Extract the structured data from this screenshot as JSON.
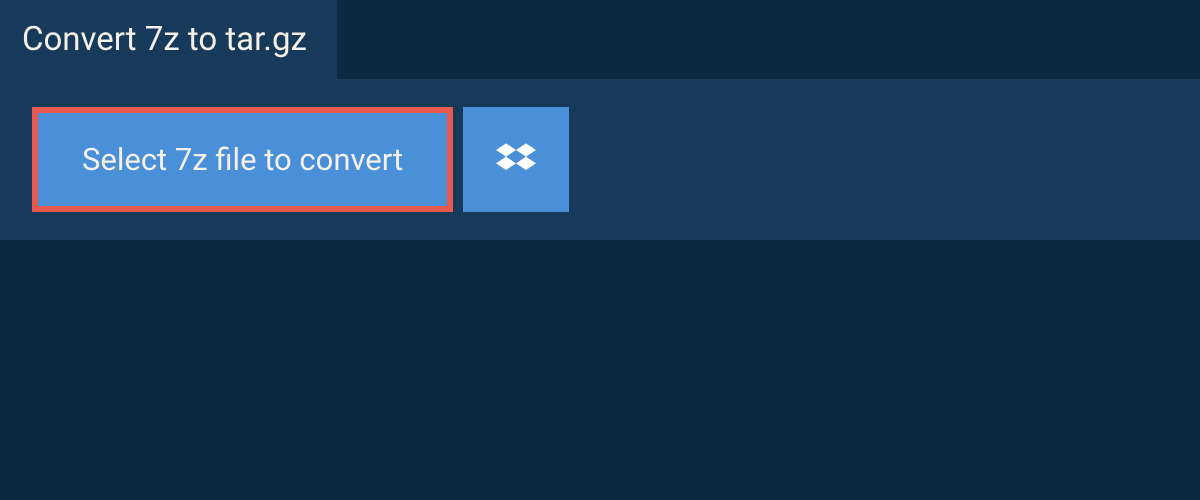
{
  "header": {
    "title": "Convert 7z to tar.gz"
  },
  "actions": {
    "select_label": "Select 7z file to convert",
    "dropbox_icon": "dropbox-icon"
  },
  "colors": {
    "bg": "#0f2942",
    "panel": "#173a5a",
    "button": "#4a90d9",
    "button_border": "#e85a4f",
    "text": "#f5f0e8"
  }
}
